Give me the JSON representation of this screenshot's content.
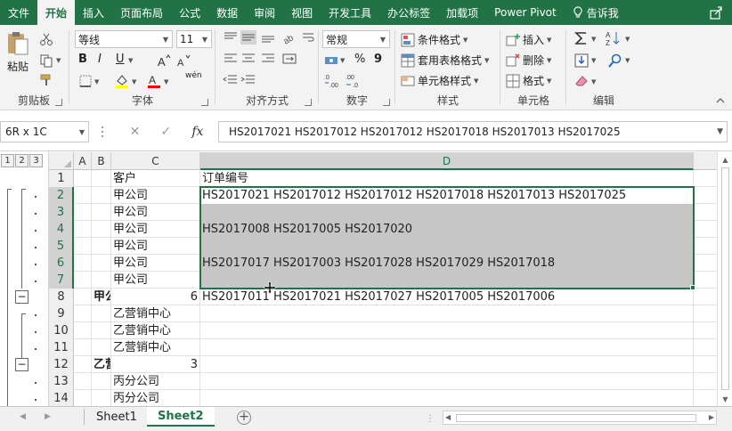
{
  "tabs": [
    {
      "label": "文件",
      "active": false
    },
    {
      "label": "开始",
      "active": true
    },
    {
      "label": "插入",
      "active": false
    },
    {
      "label": "页面布局",
      "active": false
    },
    {
      "label": "公式",
      "active": false
    },
    {
      "label": "数据",
      "active": false
    },
    {
      "label": "审阅",
      "active": false
    },
    {
      "label": "视图",
      "active": false
    },
    {
      "label": "开发工具",
      "active": false
    },
    {
      "label": "办公标签",
      "active": false
    },
    {
      "label": "加载项",
      "active": false
    },
    {
      "label": "Power Pivot",
      "active": false
    }
  ],
  "tell_me": "告诉我",
  "ribbon": {
    "clipboard": {
      "label": "剪贴板",
      "paste": "粘贴"
    },
    "font": {
      "label": "字体",
      "name": "等线",
      "size": "11",
      "bold": "B",
      "italic": "I",
      "underline": "U",
      "phonetic": "wén"
    },
    "alignment": {
      "label": "对齐方式"
    },
    "number": {
      "label": "数字",
      "format": "常规",
      "percent": "%",
      "comma": "9"
    },
    "styles": {
      "label": "样式",
      "conditional": "条件格式",
      "table": "套用表格格式",
      "cell_styles": "单元格样式"
    },
    "cells": {
      "label": "单元格",
      "insert": "插入",
      "delete": "删除",
      "format": "格式"
    },
    "editing": {
      "label": "编辑"
    }
  },
  "formula_bar": {
    "name_box": "6R x 1C",
    "fx": "fx",
    "formula": "HS2017021 HS2017012 HS2017012 HS2017018 HS2017013 HS2017025"
  },
  "outline_levels": [
    "1",
    "2",
    "3"
  ],
  "columns": [
    "A",
    "B",
    "C",
    "D"
  ],
  "rows": [
    {
      "num": "1",
      "b": "",
      "c": "客户",
      "d": "订单编号"
    },
    {
      "num": "2",
      "b": "",
      "c": "甲公司",
      "d": "HS2017021 HS2017012 HS2017012 HS2017018 HS2017013 HS2017025"
    },
    {
      "num": "3",
      "b": "",
      "c": "甲公司",
      "d": ""
    },
    {
      "num": "4",
      "b": "",
      "c": "甲公司",
      "d": "HS2017008 HS2017005 HS2017020"
    },
    {
      "num": "5",
      "b": "",
      "c": "甲公司",
      "d": ""
    },
    {
      "num": "6",
      "b": "",
      "c": "甲公司",
      "d": "HS2017017 HS2017003 HS2017028 HS2017029 HS2017018"
    },
    {
      "num": "7",
      "b": "",
      "c": "甲公司",
      "d": ""
    },
    {
      "num": "8",
      "b": "甲公",
      "c": "6",
      "d": "HS2017011 HS2017021 HS2017027 HS2017005 HS2017006"
    },
    {
      "num": "9",
      "b": "",
      "c": "乙营销中心",
      "d": ""
    },
    {
      "num": "10",
      "b": "",
      "c": "乙营销中心",
      "d": ""
    },
    {
      "num": "11",
      "b": "",
      "c": "乙营销中心",
      "d": ""
    },
    {
      "num": "12",
      "b": "乙营",
      "c": "3",
      "d": ""
    },
    {
      "num": "13",
      "b": "",
      "c": "丙分公司",
      "d": ""
    },
    {
      "num": "14",
      "b": "",
      "c": "丙分公司",
      "d": ""
    }
  ],
  "sheets": [
    {
      "label": "Sheet1",
      "active": false
    },
    {
      "label": "Sheet2",
      "active": true
    }
  ],
  "colors": {
    "accent": "#217346",
    "selection": "#c6c6c6"
  }
}
